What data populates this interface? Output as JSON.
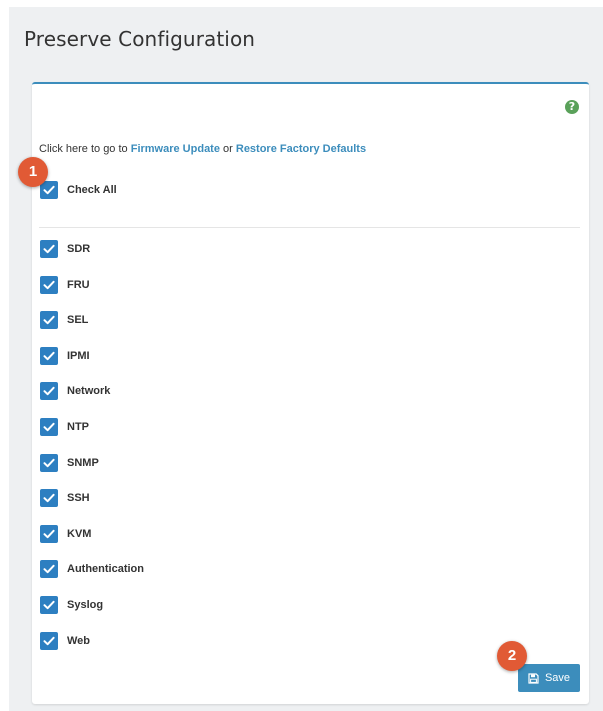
{
  "header": {
    "title": "Preserve Configuration"
  },
  "help": {
    "glyph": "?"
  },
  "nav": {
    "prefix": "Click here to go to ",
    "firmware_link": "Firmware Update",
    "or": " or ",
    "restore_link": "Restore Factory Defaults"
  },
  "check_all": {
    "label": "Check All",
    "checked": true
  },
  "items": [
    {
      "label": "SDR",
      "checked": true
    },
    {
      "label": "FRU",
      "checked": true
    },
    {
      "label": "SEL",
      "checked": true
    },
    {
      "label": "IPMI",
      "checked": true
    },
    {
      "label": "Network",
      "checked": true
    },
    {
      "label": "NTP",
      "checked": true
    },
    {
      "label": "SNMP",
      "checked": true
    },
    {
      "label": "SSH",
      "checked": true
    },
    {
      "label": "KVM",
      "checked": true
    },
    {
      "label": "Authentication",
      "checked": true
    },
    {
      "label": "Syslog",
      "checked": true
    },
    {
      "label": "Web",
      "checked": true
    }
  ],
  "save": {
    "label": "Save",
    "icon": "floppy-disk-icon"
  },
  "step_badges": [
    "1",
    "2"
  ],
  "colors": {
    "accent": "#3c8dbc",
    "checkbox": "#2d7fc1",
    "badge": "#e15a35",
    "help": "#5aa15a"
  }
}
